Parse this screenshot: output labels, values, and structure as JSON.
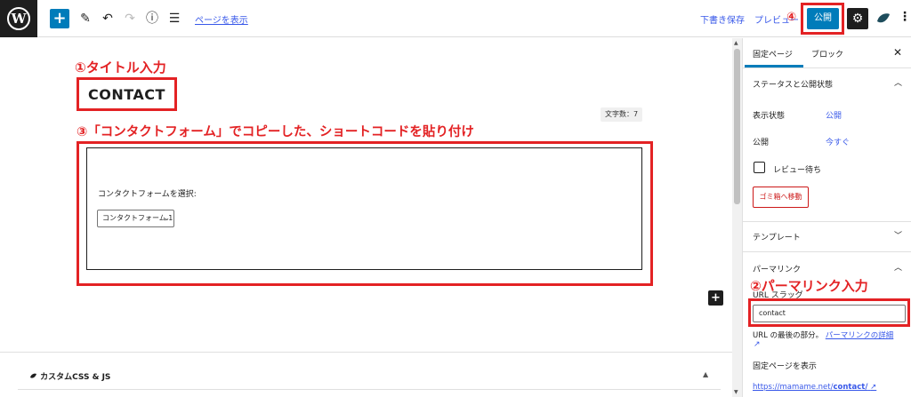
{
  "toolbar": {
    "logo": "W",
    "add_icon": "+",
    "tools_icon": "✎",
    "undo_icon": "↶",
    "redo_icon": "↷",
    "info_icon": "ⓘ",
    "outline_icon": "☰",
    "view_page": "ページを表示",
    "save_draft": "下書き保存",
    "preview": "プレビュー",
    "publish": "公開",
    "settings_icon": "⚙",
    "more_icon": "⋮"
  },
  "annotations": {
    "title_note": "①タイトル入力",
    "shortcode_note": "③「コンタクトフォーム」でコピーした、ショートコードを貼り付け",
    "publish_note": "④",
    "permalink_note": "②パーマリンク入力"
  },
  "editor": {
    "title": "CONTACT",
    "char_count": "文字数：7",
    "cf7_label": "コンタクトフォームを選択:",
    "cf7_selected": "コンタクトフォーム 1",
    "inserter_icon": "+",
    "meta_box_title": "カスタムCSS & JS",
    "meta_toggle_icon": "▲"
  },
  "sidebar": {
    "tab_page": "固定ページ",
    "tab_block": "ブロック",
    "close_icon": "✕",
    "status_heading": "ステータスと公開状態",
    "visibility_label": "表示状態",
    "visibility_value": "公開",
    "publish_label": "公開",
    "publish_value": "今すぐ",
    "pending_review": "レビュー待ち",
    "trash": "ゴミ箱へ移動",
    "template_heading": "テンプレート",
    "permalink_heading": "パーマリンク",
    "url_slug_label": "URL スラッグ",
    "slug_value": "contact",
    "url_desc": "URL の最後の部分。",
    "url_desc_link": "パーマリンクの詳細",
    "view_page_heading": "固定ページを表示",
    "permalink_url_prefix": "https://mamame.net/",
    "permalink_url_slug": "contact/"
  },
  "colors": {
    "accent": "#007cba",
    "annotation_red": "#e32224",
    "link": "#3858e9"
  }
}
